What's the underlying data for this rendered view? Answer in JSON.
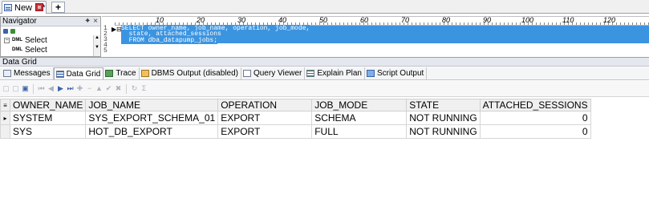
{
  "doc_tab": {
    "label": "New 1 *"
  },
  "navigator": {
    "title": "Navigator",
    "header_tools": "&#x1f4cc; ×",
    "items": [
      {
        "badge": "DML",
        "label": "Select",
        "expander": "−"
      },
      {
        "badge": "DML",
        "label": "Select"
      }
    ]
  },
  "editor": {
    "ruler_ticks": [
      "10",
      "20",
      "30",
      "40",
      "50",
      "60",
      "70",
      "80",
      "90",
      "100",
      "110",
      "120"
    ],
    "line_numbers": [
      "1",
      "2",
      "3",
      "4",
      "5"
    ],
    "lines": [
      "SELECT owner_name, job_name, operation, job_mode,",
      "  state, attached_sessions",
      "  FROM dba_datapump_jobs;",
      "",
      ""
    ]
  },
  "data_grid": {
    "panel_title": "Data Grid",
    "tabs": [
      {
        "label": "Messages",
        "icon": "messages-icon"
      },
      {
        "label": "Data Grid",
        "icon": "grid-icon",
        "active": true
      },
      {
        "label": "Trace",
        "icon": "trace-icon"
      },
      {
        "label": "DBMS Output (disabled)",
        "icon": "dbms-output-icon"
      },
      {
        "label": "Query Viewer",
        "icon": "query-viewer-icon"
      },
      {
        "label": "Explain Plan",
        "icon": "explain-plan-icon"
      },
      {
        "label": "Script Output",
        "icon": "script-output-icon"
      }
    ],
    "columns": [
      "OWNER_NAME",
      "JOB_NAME",
      "OPERATION",
      "JOB_MODE",
      "STATE",
      "ATTACHED_SESSIONS"
    ],
    "rows": [
      [
        "SYSTEM",
        "SYS_EXPORT_SCHEMA_01",
        "EXPORT",
        "SCHEMA",
        "NOT RUNNING",
        "0"
      ],
      [
        "SYS",
        "HOT_DB_EXPORT",
        "EXPORT",
        "FULL",
        "NOT RUNNING",
        "0"
      ]
    ]
  },
  "colors": {
    "selection": "#3b94e0",
    "panel_header": "#e4e8ee"
  }
}
